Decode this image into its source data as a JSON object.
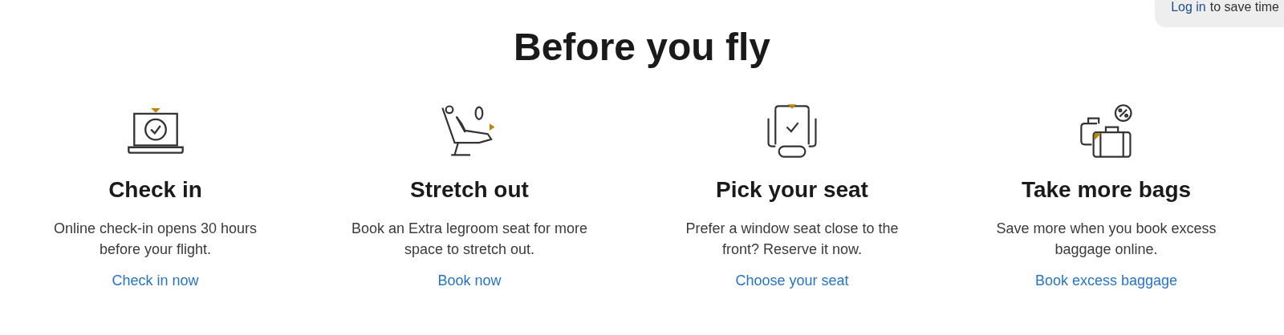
{
  "login_banner": {
    "link": "Log in",
    "text": "to save time"
  },
  "title": "Before you fly",
  "cards": [
    {
      "kind": "laptop",
      "heading": "Check in",
      "description": "Online check-in opens 30 hours before your flight.",
      "link": "Check in now"
    },
    {
      "kind": "recliner",
      "heading": "Stretch out",
      "description": "Book an Extra legroom seat for more space to stretch out.",
      "link": "Book now"
    },
    {
      "kind": "seat",
      "heading": "Pick your seat",
      "description": "Prefer a window seat close to the front? Reserve it now.",
      "link": "Choose your seat"
    },
    {
      "kind": "bags",
      "heading": "Take more bags",
      "description": "Save more when you book excess baggage online.",
      "link": "Book excess baggage"
    }
  ]
}
